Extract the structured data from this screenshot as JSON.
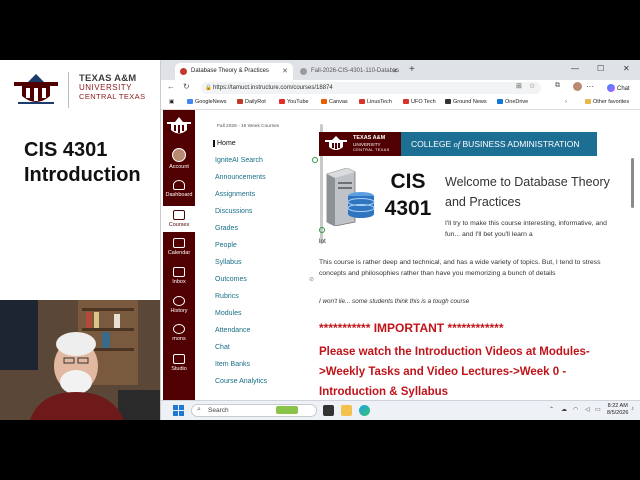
{
  "slide": {
    "university": {
      "line1": "TEXAS A&M",
      "line2": "UNIVERSITY",
      "line3": "CENTRAL TEXAS"
    },
    "title_line1": "CIS 4301",
    "title_line2": "Introduction"
  },
  "browser": {
    "tabs": [
      {
        "label": "Database Theory & Practices",
        "active": true
      },
      {
        "label": "Fall-2026-CIS-4301-110-Databas",
        "active": false
      }
    ],
    "url": "https://tamuct.instructure.com/courses/18874",
    "profile_label": "Chat",
    "bookmarks": [
      {
        "label": "GoogleNews",
        "color": "#4285f4"
      },
      {
        "label": "DailyRot",
        "color": "#c0392b"
      },
      {
        "label": "YouTube",
        "color": "#e52d27"
      },
      {
        "label": "Canvas",
        "color": "#e66000"
      },
      {
        "label": "LinusTech",
        "color": "#d9342b"
      },
      {
        "label": "UFO Tech",
        "color": "#d9342b"
      },
      {
        "label": "Ground News",
        "color": "#333333"
      },
      {
        "label": "OneDrive",
        "color": "#0f78d4"
      }
    ],
    "other_favorites": "Other favorites"
  },
  "canvas": {
    "global_nav": [
      {
        "label": "Account"
      },
      {
        "label": "Dashboard"
      },
      {
        "label": "Courses"
      },
      {
        "label": "Calendar"
      },
      {
        "label": "Inbox"
      },
      {
        "label": "History"
      },
      {
        "label": "mons"
      },
      {
        "label": "Studio"
      }
    ],
    "term": "Fall 2026 - 16 Week Courses",
    "course_nav": [
      "Home",
      "IgniteAI Search",
      "Announcements",
      "Assignments",
      "Discussions",
      "Grades",
      "People",
      "Syllabus",
      "Outcomes",
      "Rubrics",
      "Modules",
      "Attendance",
      "Chat",
      "Item Banks",
      "Course Analytics"
    ],
    "banner": {
      "uni_l1": "TEXAS A&M",
      "uni_l2": "UNIVERSITY",
      "uni_l3": "CENTRAL TEXAS",
      "college_pre": "COLLEGE ",
      "college_of": "of",
      "college_post": " BUSINESS ADMINISTRATION"
    },
    "course_number_l1": "CIS",
    "course_number_l2": "4301",
    "welcome": "Welcome to Database Theory and Practices",
    "intro": "I'll try to make this course interesting, informative, and fun... and I'll bet you'll learn a",
    "lot": "lot",
    "paragraph": "This course is rather deep and technical, and has a wide variety of topics. But, I tend to stress concepts and philosophies rather than have you memorizing a bunch of details",
    "warning": "I won't lie... some students think this is a tough course",
    "important": "*********** IMPORTANT ************",
    "watch": "Please watch the Introduction Videos at Modules->Weekly Tasks and Video Lectures->Week 0 - Introduction & Syllabus"
  },
  "taskbar": {
    "search_placeholder": "Search",
    "time": "8:22 AM",
    "date": "8/5/2026"
  }
}
